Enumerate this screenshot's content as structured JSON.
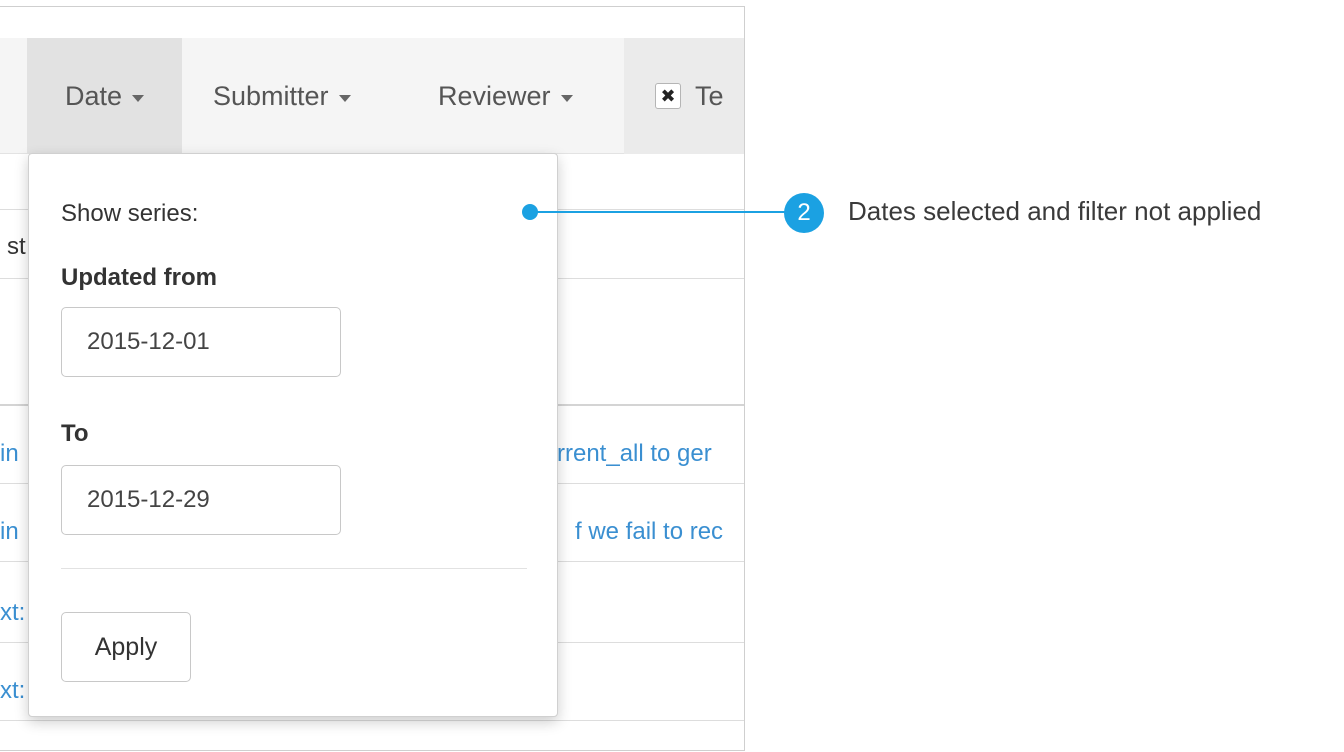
{
  "navbar": {
    "date_label": "Date",
    "submitter_label": "Submitter",
    "reviewer_label": "Reviewer",
    "filter_chip_check": "✖",
    "filter_chip_label": "Te"
  },
  "background_rows": {
    "row1_left": "st",
    "row2_left": "in",
    "row2_right": "rrent_all to ger",
    "row3_left": "in",
    "row3_right": "f we fail to rec",
    "row4_left": "xt:",
    "row5_left": "xt:"
  },
  "dropdown": {
    "heading": "Show series:",
    "from_label": "Updated from",
    "from_value": "2015-12-01",
    "to_label": "To",
    "to_value": "2015-12-29",
    "apply_label": "Apply"
  },
  "callout": {
    "number": "2",
    "text": "Dates selected and filter not applied",
    "color": "#1ba1e2"
  }
}
